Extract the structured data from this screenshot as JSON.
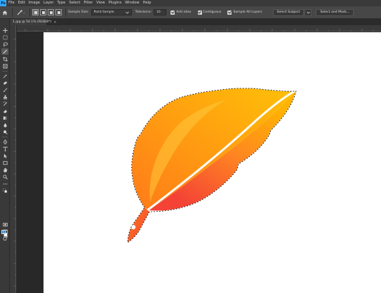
{
  "app": {
    "logo_text": "Ps"
  },
  "menu": [
    "File",
    "Edit",
    "Image",
    "Layer",
    "Type",
    "Select",
    "Filter",
    "View",
    "Plugins",
    "Window",
    "Help"
  ],
  "options_bar": {
    "sample_size_label": "Sample Size:",
    "sample_size_value": "Point Sample",
    "tolerance_label": "Tolerance:",
    "tolerance_value": "10",
    "anti_alias_label": "Anti-alias",
    "contiguous_label": "Contiguous",
    "sample_all_layers_label": "Sample All Layers",
    "select_subject_label": "Select Subject",
    "select_and_mask_label": "Select and Mask..."
  },
  "document": {
    "tab_title": "1.jpg @ 54.1% (RGB/8*)",
    "close_glyph": "×"
  },
  "colors": {
    "foreground": "#1e7bc7",
    "background": "#ffffff",
    "feather_light": "#ffb300",
    "feather_mid": "#ff8a1f",
    "feather_dark": "#f44336",
    "ps_blue": "#31a8ff"
  },
  "tools": [
    "move-tool",
    "marquee-tool",
    "lasso-tool",
    "magic-wand-tool",
    "crop-tool",
    "frame-tool",
    "eyedropper-tool",
    "healing-brush-tool",
    "brush-tool",
    "clone-stamp-tool",
    "history-brush-tool",
    "eraser-tool",
    "gradient-tool",
    "blur-tool",
    "dodge-tool",
    "pen-tool",
    "type-tool",
    "path-selection-tool",
    "rectangle-tool",
    "hand-tool",
    "zoom-tool",
    "more-tools",
    "quick-mask",
    "screen-mode"
  ]
}
